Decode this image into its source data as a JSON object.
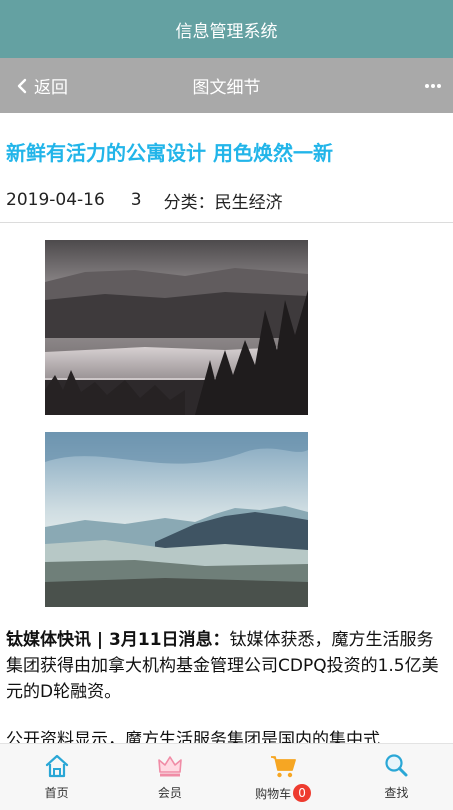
{
  "app": {
    "title": "信息管理系统"
  },
  "nav": {
    "back_label": "返回",
    "title": "图文细节",
    "more_icon": "more-dots-icon"
  },
  "article": {
    "title": "新鲜有活力的公寓设计 用色焕然一新",
    "date": "2019-04-16",
    "count": "3",
    "category_label": "分类：民生经济",
    "paragraph1_lead": "钛媒体快讯 | 3月11日消息：",
    "paragraph1_body": "钛媒体获悉，魔方生活服务集团获得由加拿大机构基金管理公司CDPQ投资的1.5亿美元的D轮融资。",
    "paragraph2": "公开资料显示，魔方生活服务集团是国内的集中式"
  },
  "tabbar": {
    "items": [
      {
        "label": "首页",
        "icon": "home-icon"
      },
      {
        "label": "会员",
        "icon": "crown-icon"
      },
      {
        "label": "购物车",
        "icon": "cart-icon",
        "badge": "0"
      },
      {
        "label": "查找",
        "icon": "search-icon"
      }
    ]
  },
  "colors": {
    "header": "#64a1a2",
    "nav": "#a9a9a9",
    "title": "#22b5e9",
    "accent": "#2aa7d6",
    "badge": "#ee3b2f"
  }
}
